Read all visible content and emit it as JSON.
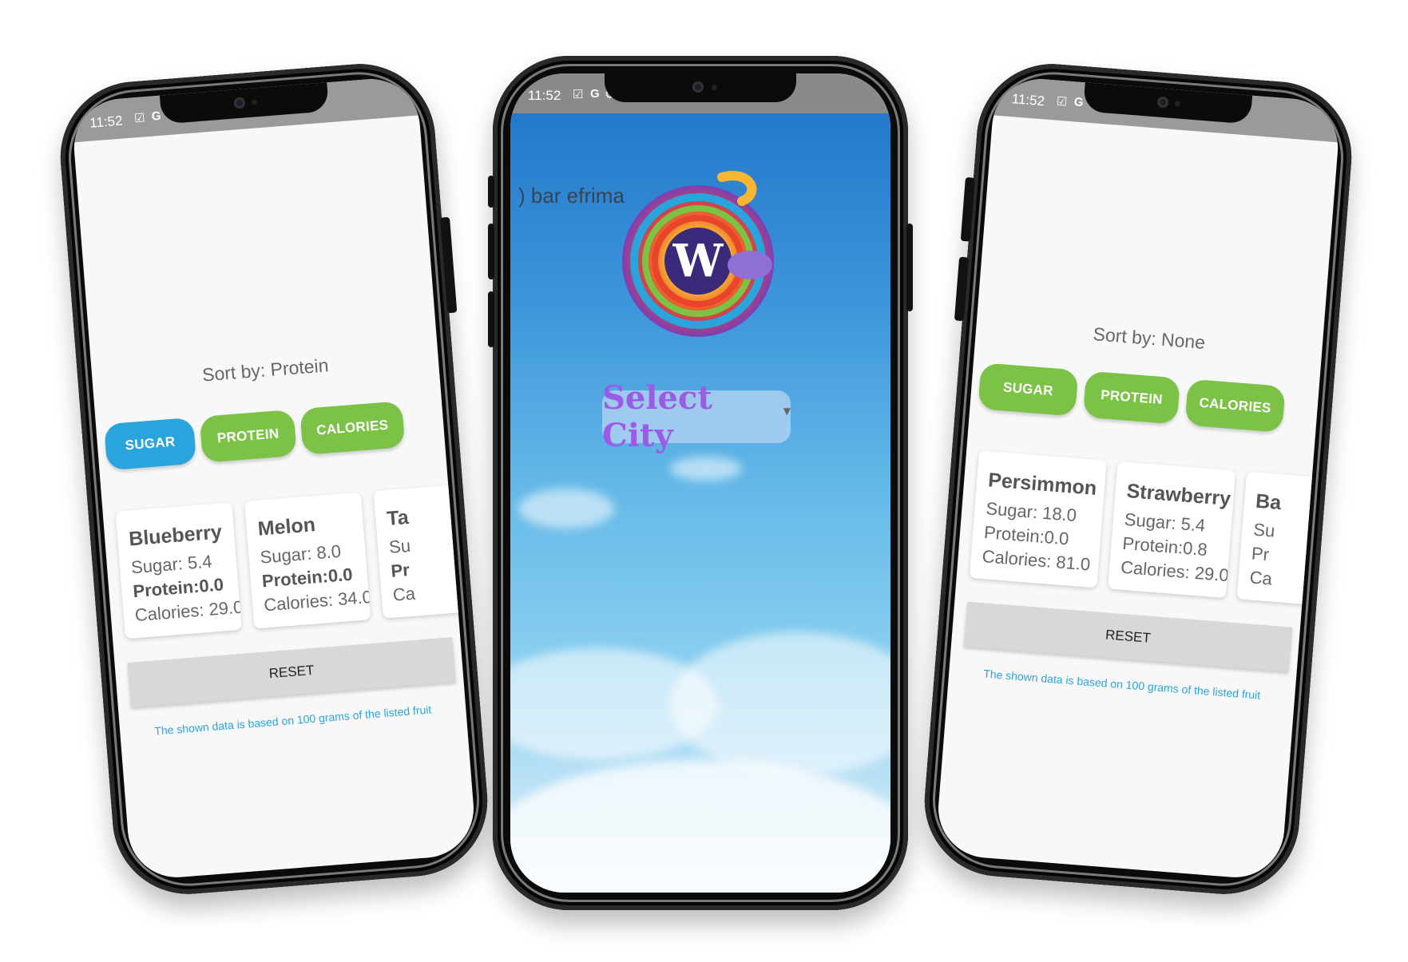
{
  "status": {
    "time": "11:52",
    "icons": [
      "check-icon",
      "google-g-icon",
      "gear-icon"
    ]
  },
  "left_phone": {
    "sort_label": "Sort by: Protein",
    "buttons": [
      {
        "label": "SUGAR",
        "state": "selected",
        "color": "#2aa4dc"
      },
      {
        "label": "PROTEIN",
        "state": "default",
        "color": "#7cc247"
      },
      {
        "label": "CALORIES",
        "state": "default",
        "color": "#7cc247"
      }
    ],
    "cards": [
      {
        "name": "Blueberry",
        "sugar": "Sugar: 5.4",
        "protein": "Protein:0.0",
        "calories": "Calories: 29.0"
      },
      {
        "name": "Melon",
        "sugar": "Sugar: 8.0",
        "protein": "Protein:0.0",
        "calories": "Calories: 34.0"
      },
      {
        "name": "Ta",
        "sugar": "Su",
        "protein": "Pr",
        "calories": "Ca"
      }
    ],
    "reset_label": "RESET",
    "note": "The shown data is based on 100 grams of the listed fruit"
  },
  "center_phone": {
    "back_text": ") bar efrima",
    "logo_letter": "W",
    "select_label": "Select City"
  },
  "right_phone": {
    "sort_label": "Sort by: None",
    "buttons": [
      {
        "label": "SUGAR",
        "state": "default",
        "color": "#7cc247"
      },
      {
        "label": "PROTEIN",
        "state": "default",
        "color": "#7cc247"
      },
      {
        "label": "CALORIES",
        "state": "default",
        "color": "#7cc247"
      }
    ],
    "cards": [
      {
        "name": "Persimmon",
        "sugar": "Sugar: 18.0",
        "protein": "Protein:0.0",
        "calories": "Calories: 81.0"
      },
      {
        "name": "Strawberry",
        "sugar": "Sugar: 5.4",
        "protein": "Protein:0.8",
        "calories": "Calories: 29.0"
      },
      {
        "name": "Ba",
        "sugar": "Su",
        "protein": "Pr",
        "calories": "Ca"
      }
    ],
    "reset_label": "RESET",
    "note": "The shown data is based on 100 grams of the listed fruit"
  }
}
